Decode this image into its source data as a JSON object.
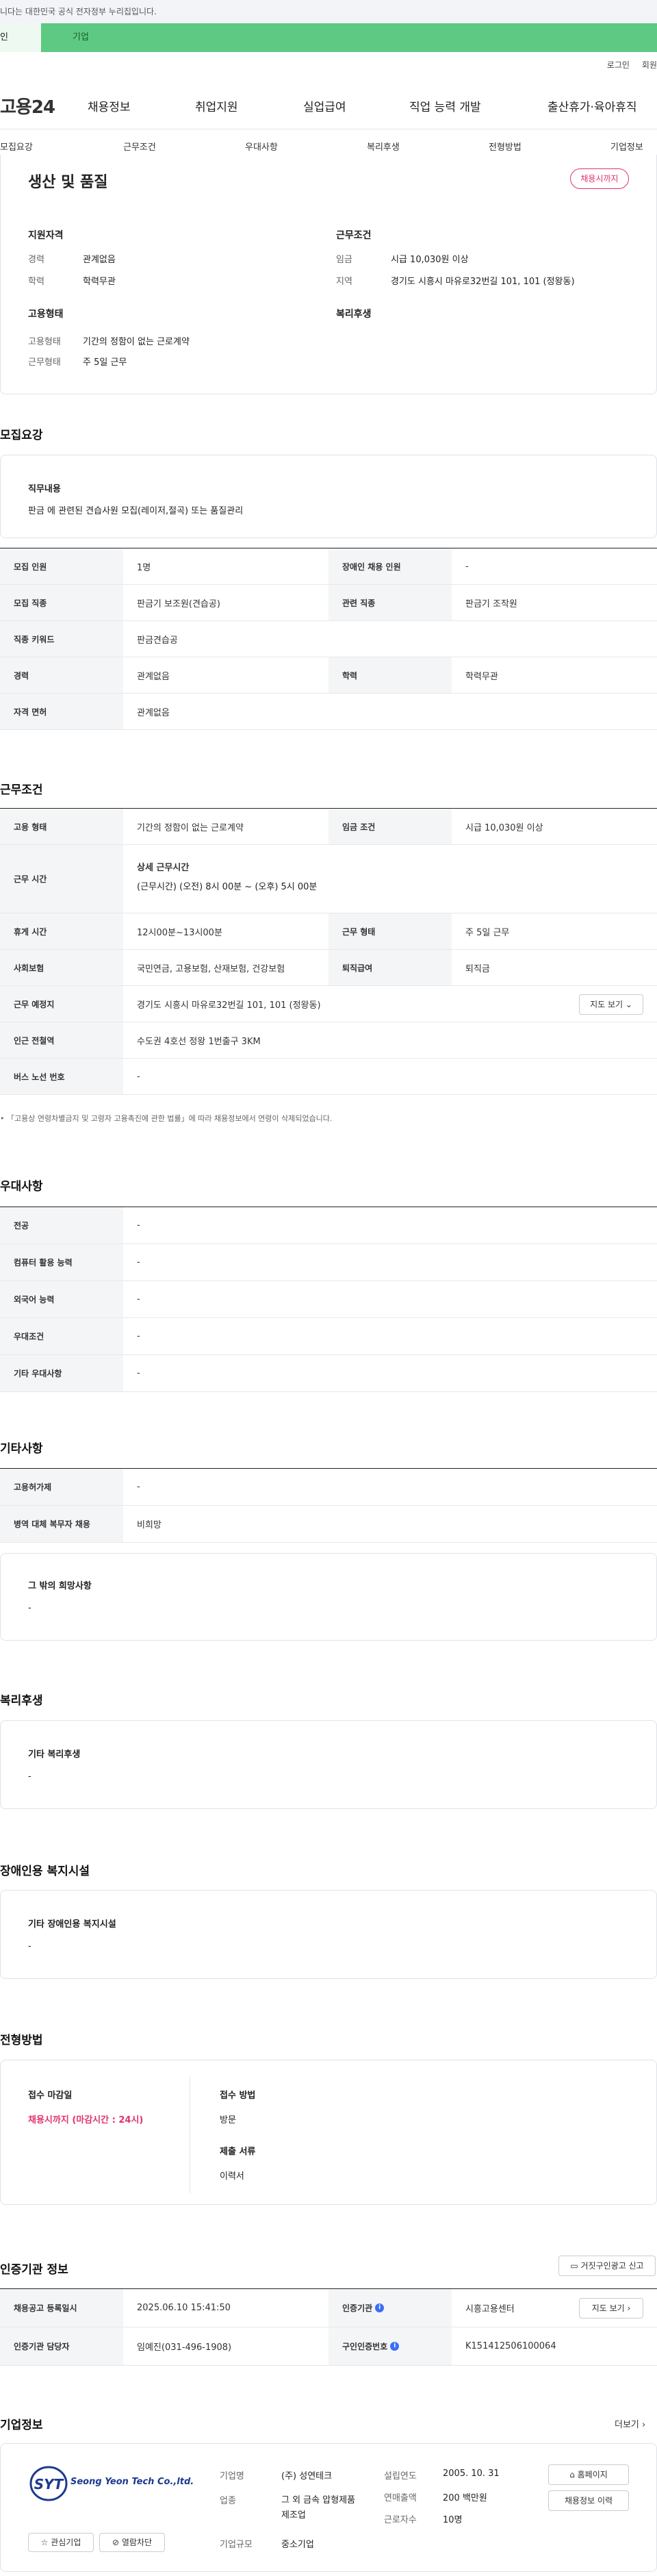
{
  "gov_banner": "니다는 대한민국 공식 전자정부 누리집입니다.",
  "top_tabs": [
    "인",
    "기업"
  ],
  "util": [
    "로그인",
    "회원"
  ],
  "logo": "고용24",
  "gnav": [
    "채용정보",
    "취업지원",
    "실업급여",
    "직업 능력 개발",
    "출산휴가·육아휴직"
  ],
  "lnav": [
    "모집요강",
    "근무조건",
    "우대사항",
    "복리후생",
    "전형방법",
    "기업정보"
  ],
  "summary": {
    "title": "생산 및 품질",
    "badge": "채용시까지",
    "qual_title": "지원자격",
    "career_label": "경력",
    "career": "관계없음",
    "edu_label": "학력",
    "edu": "학력무관",
    "emp_title": "고용형태",
    "emptype_label": "고용형태",
    "emptype": "기간의 정함이 없는 근로계약",
    "worktype_label": "근무형태",
    "worktype": "주 5일 근무",
    "cond_title": "근무조건",
    "wage_label": "임금",
    "wage": "시급 10,030원 이상",
    "area_label": "지역",
    "area": "경기도 시흥시 마유로32번길 101, 101 (정왕동)",
    "welfare_title": "복리후생"
  },
  "recruit": {
    "title": "모집요강",
    "duty_label": "직무내용",
    "duty": "판금 에 관련된 견습사원 모집(레이저,절곡) 또는 품질관리",
    "rows": [
      {
        "h1": "모집 인원",
        "d1": "1명",
        "h2": "장애인 채용 인원",
        "d2": "-"
      },
      {
        "h1": "모집 직종",
        "d1": "판금기 보조원(견습공)",
        "h2": "관련 직종",
        "d2": "판금기 조작원"
      },
      {
        "h1": "직종 키워드",
        "d1": "판금견습공"
      },
      {
        "h1": "경력",
        "d1": "관계없음",
        "h2": "학력",
        "d2": "학력무관"
      },
      {
        "h1": "자격 면허",
        "d1": "관계없음"
      }
    ]
  },
  "work": {
    "title": "근무조건",
    "emp_h": "고용 형태",
    "emp_d": "기간의 정함이 없는 근로계약",
    "wage_h": "임금 조건",
    "wage_d": "시급 10,030원 이상",
    "time_h": "근무 시간",
    "time_sub": "상세 근무시간",
    "time_d": "(근무시간) (오전) 8시 00분 ~ (오후) 5시 00분",
    "rest_h": "휴게 시간",
    "rest_d": "12시00분~13시00분",
    "form_h": "근무 형태",
    "form_d": "주 5일 근무",
    "ins_h": "사회보험",
    "ins_d": "국민연금, 고용보험, 산재보험, 건강보험",
    "sev_h": "퇴직급여",
    "sev_d": "퇴직금",
    "place_h": "근무 예정지",
    "place_d": "경기도 시흥시 마유로32번길 101, 101 (정왕동)",
    "map_btn": "지도 보기",
    "subway_h": "인근 전철역",
    "subway_d": "수도권 4호선 정왕 1번출구 3KM",
    "bus_h": "버스 노선 번호",
    "bus_d": "-",
    "note": "「고용상 연령차별금지 및 고령자 고용촉진에 관한 법률」에 따라 채용정보에서 연령이 삭제되었습니다."
  },
  "pref": {
    "title": "우대사항",
    "rows": [
      {
        "h": "전공",
        "d": "-"
      },
      {
        "h": "컴퓨터 활용 능력",
        "d": "-"
      },
      {
        "h": "외국어 능력",
        "d": "-"
      },
      {
        "h": "우대조건",
        "d": "-"
      },
      {
        "h": "기타 우대사항",
        "d": "-"
      }
    ]
  },
  "etc": {
    "title": "기타사항",
    "rows": [
      {
        "h": "고용허가제",
        "d": "-"
      },
      {
        "h": "병역 대체 복무자 채용",
        "d": "비희망"
      }
    ],
    "hope_label": "그 밖의 희망사항",
    "hope": "-"
  },
  "welfare": {
    "title": "복리후생",
    "label": "기타 복리후생",
    "value": "-"
  },
  "disabled": {
    "title": "장애인용 복지시설",
    "label": "기타 장애인용 복지시설",
    "value": "-"
  },
  "selection": {
    "title": "전형방법",
    "deadline_label": "접수 마감일",
    "deadline": "채용시까지 (마감시간 : 24시)",
    "method_label": "접수 방법",
    "method": "방문",
    "docs_label": "제출 서류",
    "docs": "이력서"
  },
  "agency": {
    "title": "인증기관 정보",
    "report_btn": "거짓구인광고 신고",
    "reg_h": "채용공고 등록일시",
    "reg_d": "2025.06.10 15:41:50",
    "org_h": "인증기관",
    "org_d": "시흥고용센터",
    "map_btn": "지도 보기",
    "mgr_h": "인증기관 담당자",
    "mgr_d": "임예진(031-496-1908)",
    "no_h": "구인인증번호",
    "no_d": "K151412506100064"
  },
  "company": {
    "title": "기업정보",
    "more": "더보기",
    "logo_text": "Seong Yeon Tech Co.,ltd.",
    "logo_mark": "SYT",
    "fav_btn": "관심기업",
    "block_btn": "열람차단",
    "name_h": "기업명",
    "name_d": "(주) 성연테크",
    "biz_h": "업종",
    "biz_d": "그 외 금속 압형제품 제조업",
    "size_h": "기업규모",
    "size_d": "중소기업",
    "year_h": "설립연도",
    "year_d": "2005. 10. 31",
    "sales_h": "연매출액",
    "sales_d": "200 백만원",
    "emp_h": "근로자수",
    "emp_d": "10명",
    "home_btn": "홈페이지",
    "jobs_btn": "채용정보 이력"
  }
}
